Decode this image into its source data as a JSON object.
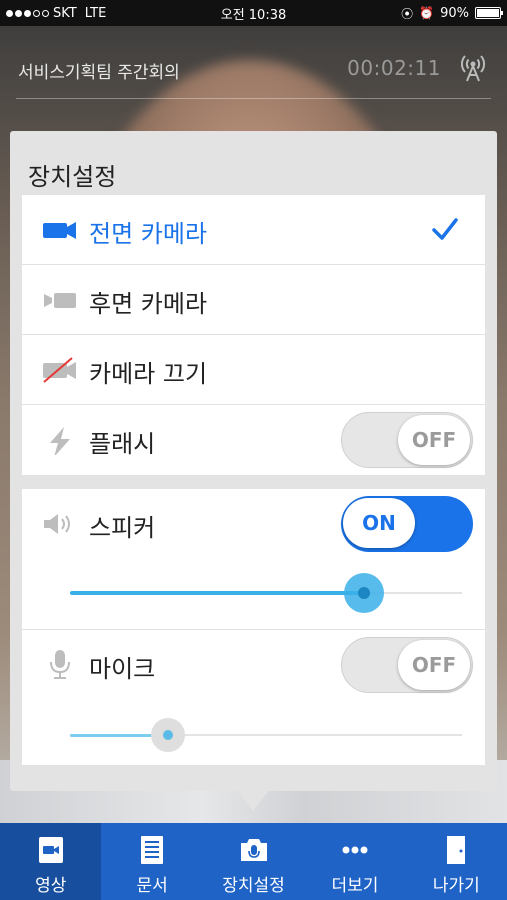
{
  "status_bar": {
    "carrier": "SKT",
    "network": "LTE",
    "time": "오전 10:38",
    "battery": "90%"
  },
  "meeting": {
    "title": "서비스기획팀 주간회의",
    "timer": "00:02:11"
  },
  "popup": {
    "title": "장치설정",
    "camera_options": [
      {
        "label": "전면 카메라",
        "icon": "front-camera-icon",
        "selected": true
      },
      {
        "label": "후면 카메라",
        "icon": "rear-camera-icon",
        "selected": false
      },
      {
        "label": "카메라 끄기",
        "icon": "camera-off-icon",
        "selected": false
      },
      {
        "label": "플래시",
        "icon": "flash-icon",
        "toggle": "OFF"
      }
    ],
    "speaker": {
      "label": "스피커",
      "toggle": "ON",
      "volume": 0.75
    },
    "mic": {
      "label": "마이크",
      "toggle": "OFF",
      "volume": 0.25
    }
  },
  "tabs": [
    {
      "label": "영상",
      "icon": "video-icon",
      "active": true
    },
    {
      "label": "문서",
      "icon": "document-icon",
      "active": false
    },
    {
      "label": "장치설정",
      "icon": "device-settings-icon",
      "active": false
    },
    {
      "label": "더보기",
      "icon": "more-icon",
      "active": false
    },
    {
      "label": "나가기",
      "icon": "exit-door-icon",
      "active": false
    }
  ],
  "colors": {
    "accent": "#1a73e8",
    "tabbar": "#1f63c7",
    "tab_active": "#174e9e"
  }
}
